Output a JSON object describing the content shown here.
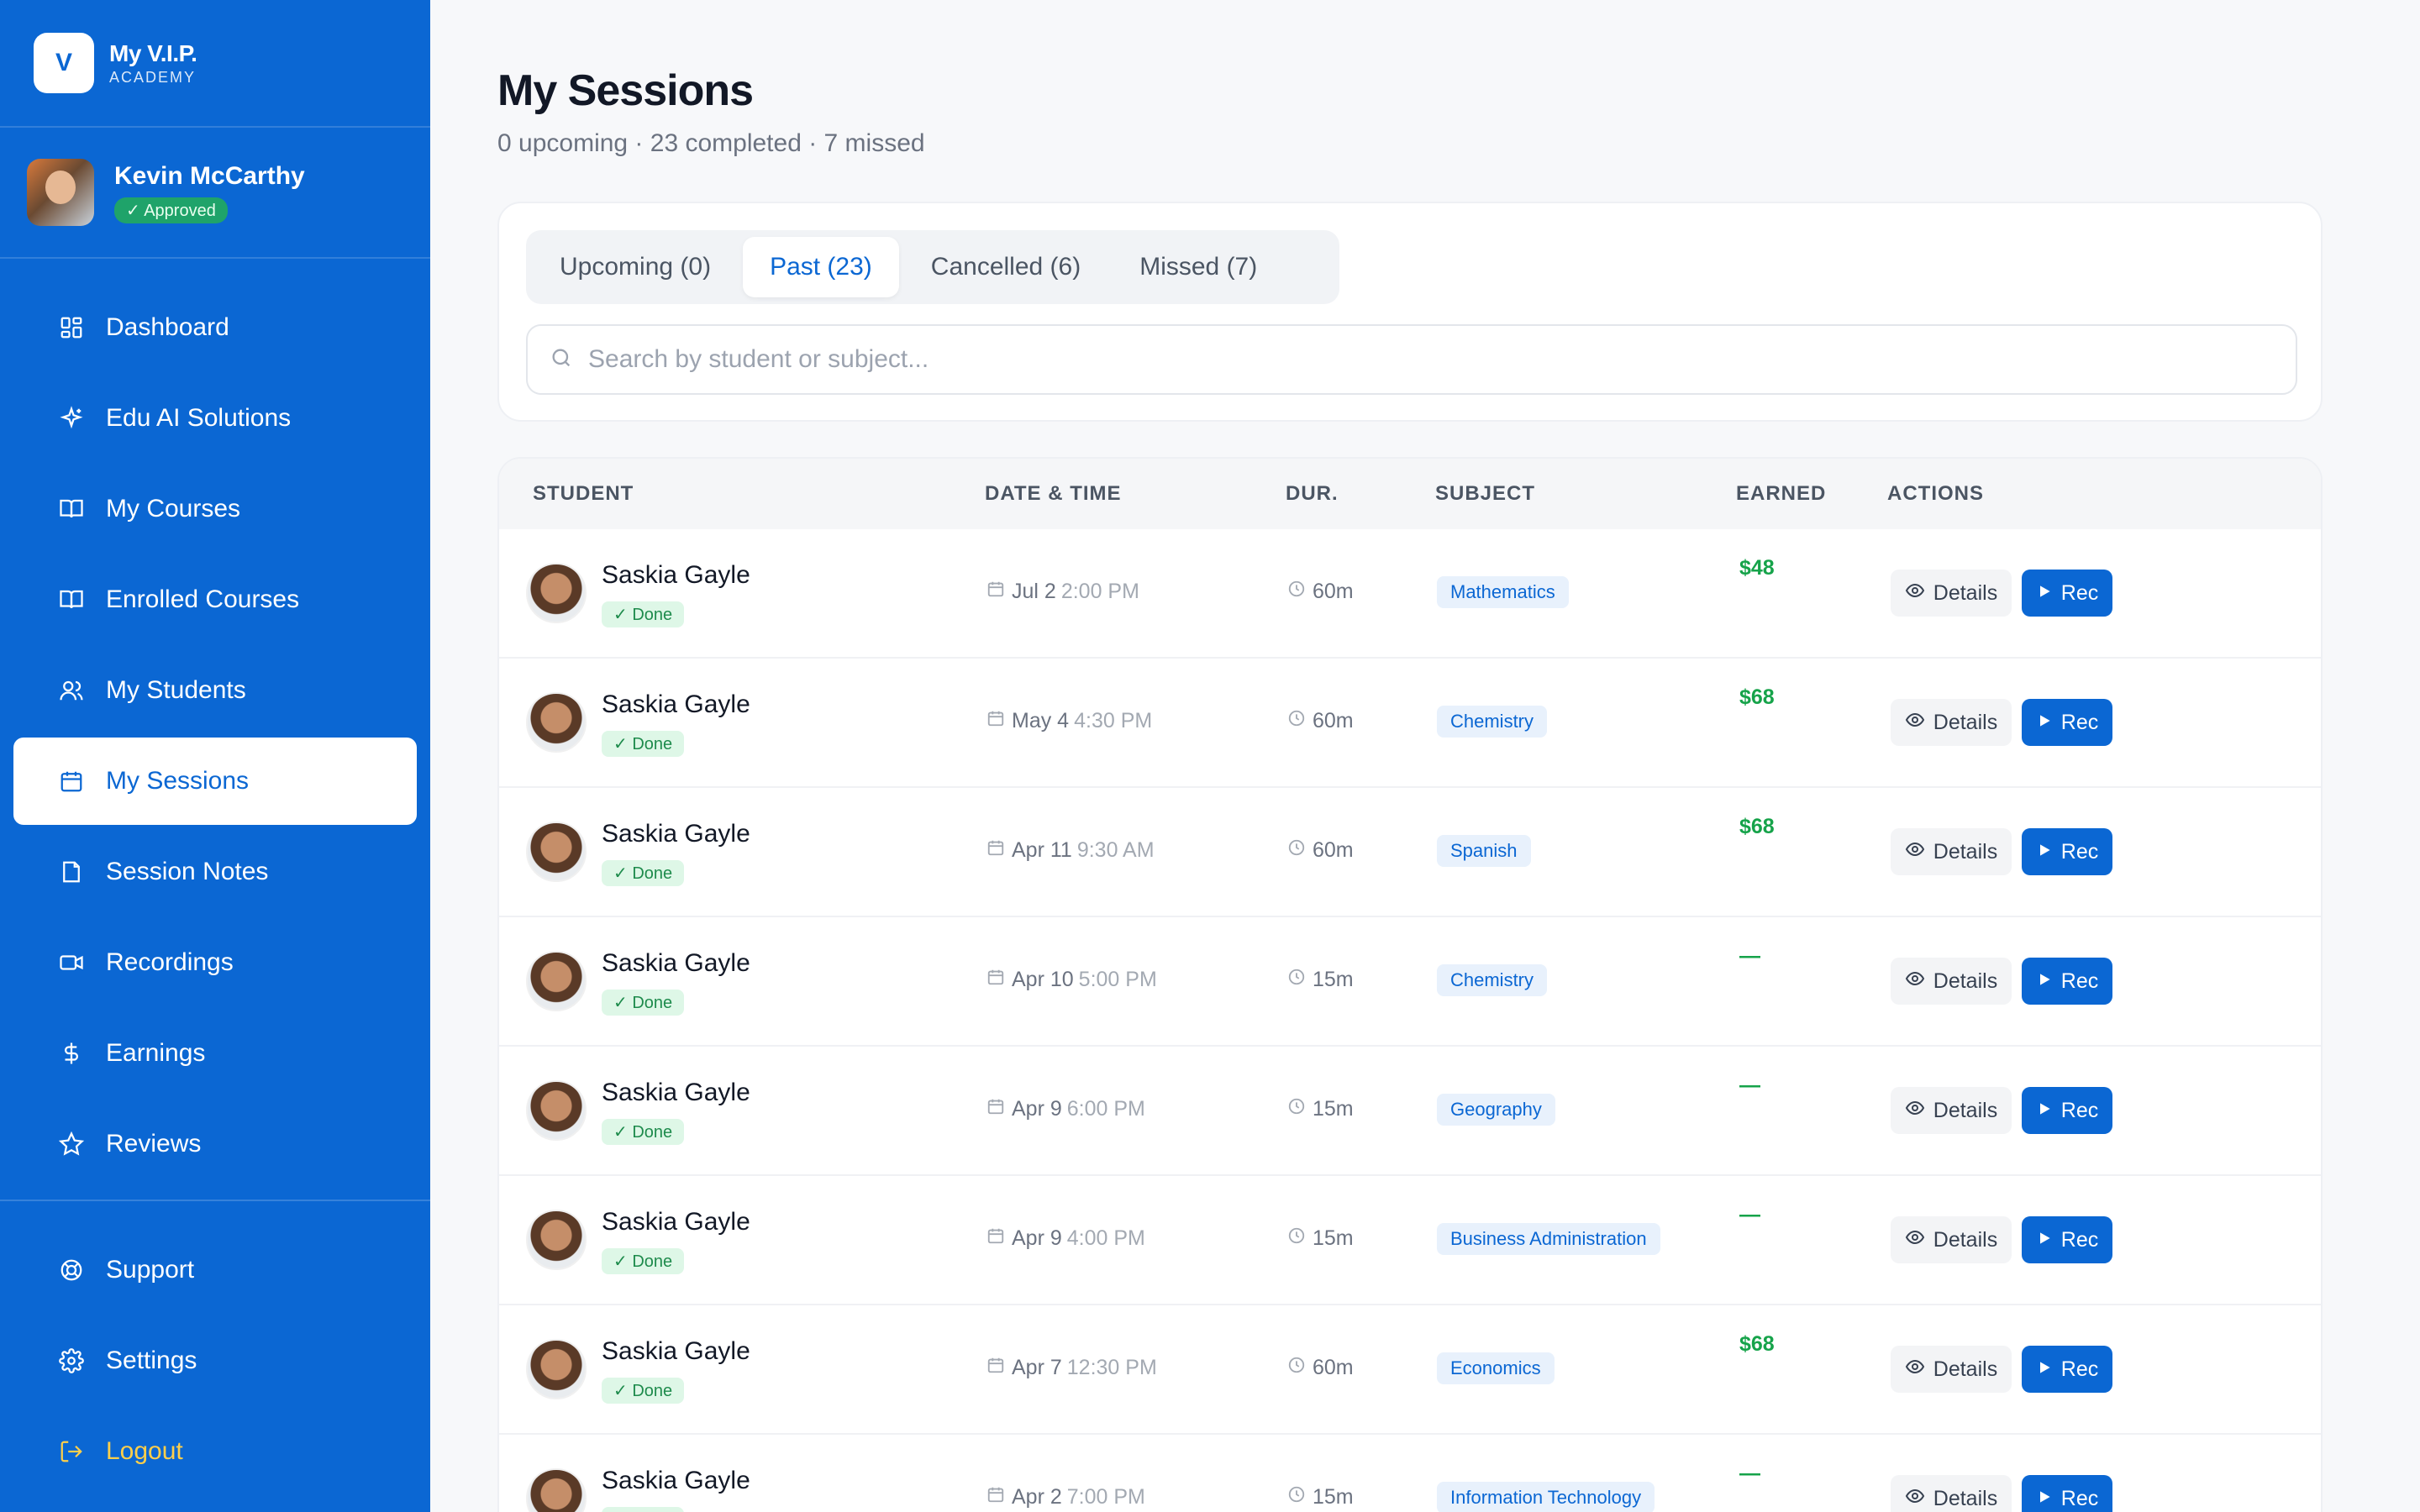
{
  "brand": {
    "logo_letter": "V",
    "name": "My V.I.P.",
    "sub": "ACADEMY"
  },
  "profile": {
    "name": "Kevin McCarthy",
    "badge": "✓ Approved"
  },
  "nav": {
    "items": [
      {
        "label": "Dashboard",
        "icon": "dashboard-icon"
      },
      {
        "label": "Edu AI Solutions",
        "icon": "sparkle-icon"
      },
      {
        "label": "My Courses",
        "icon": "book-icon"
      },
      {
        "label": "Enrolled Courses",
        "icon": "book-icon"
      },
      {
        "label": "My Students",
        "icon": "users-icon"
      },
      {
        "label": "My Sessions",
        "icon": "calendar-icon"
      },
      {
        "label": "Session Notes",
        "icon": "note-icon"
      },
      {
        "label": "Recordings",
        "icon": "video-icon"
      },
      {
        "label": "Earnings",
        "icon": "dollar-icon"
      },
      {
        "label": "Reviews",
        "icon": "star-icon"
      }
    ],
    "bottom": [
      {
        "label": "Support",
        "icon": "lifebuoy-icon"
      },
      {
        "label": "Settings",
        "icon": "gear-icon"
      },
      {
        "label": "Logout",
        "icon": "logout-icon"
      }
    ]
  },
  "page": {
    "title": "My Sessions",
    "subtitle": "0 upcoming · 23 completed · 7 missed"
  },
  "tabs": [
    "Upcoming (0)",
    "Past (23)",
    "Cancelled (6)",
    "Missed (7)"
  ],
  "search": {
    "placeholder": "Search by student or subject..."
  },
  "table": {
    "headers": [
      "STUDENT",
      "DATE & TIME",
      "DUR.",
      "SUBJECT",
      "EARNED",
      "ACTIONS"
    ],
    "details_label": "Details",
    "rec_label": "Rec",
    "rows": [
      {
        "student": "Saskia Gayle",
        "status": "✓ Done",
        "date": "Jul 2",
        "time": "2:00 PM",
        "dur": "60m",
        "subject": "Mathematics",
        "earned": "$48"
      },
      {
        "student": "Saskia Gayle",
        "status": "✓ Done",
        "date": "May 4",
        "time": "4:30 PM",
        "dur": "60m",
        "subject": "Chemistry",
        "earned": "$68"
      },
      {
        "student": "Saskia Gayle",
        "status": "✓ Done",
        "date": "Apr 11",
        "time": "9:30 AM",
        "dur": "60m",
        "subject": "Spanish",
        "earned": "$68"
      },
      {
        "student": "Saskia Gayle",
        "status": "✓ Done",
        "date": "Apr 10",
        "time": "5:00 PM",
        "dur": "15m",
        "subject": "Chemistry",
        "earned": "—"
      },
      {
        "student": "Saskia Gayle",
        "status": "✓ Done",
        "date": "Apr 9",
        "time": "6:00 PM",
        "dur": "15m",
        "subject": "Geography",
        "earned": "—"
      },
      {
        "student": "Saskia Gayle",
        "status": "✓ Done",
        "date": "Apr 9",
        "time": "4:00 PM",
        "dur": "15m",
        "subject": "Business Administration",
        "earned": "—"
      },
      {
        "student": "Saskia Gayle",
        "status": "✓ Done",
        "date": "Apr 7",
        "time": "12:30 PM",
        "dur": "60m",
        "subject": "Economics",
        "earned": "$68"
      },
      {
        "student": "Saskia Gayle",
        "status": "✓ Done",
        "date": "Apr 2",
        "time": "7:00 PM",
        "dur": "15m",
        "subject": "Information Technology",
        "earned": "—"
      }
    ]
  }
}
